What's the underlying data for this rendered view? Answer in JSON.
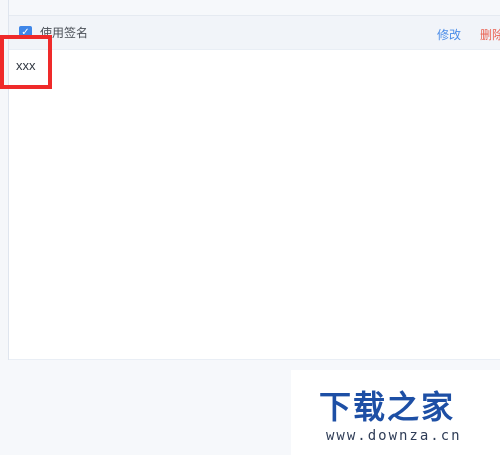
{
  "signature_panel": {
    "use_signature_label": "使用签名",
    "use_signature_checked": true,
    "edit_label": "修改",
    "delete_label": "删除",
    "signature_text": "xxx"
  },
  "watermark": {
    "brand_text": "下载之家",
    "url_text": "www.downza.cn"
  },
  "colors": {
    "accent": "#4a8ce8",
    "danger": "#ea5f4f",
    "highlight": "#ef2a2a",
    "checkbox": "#3f86e8"
  }
}
